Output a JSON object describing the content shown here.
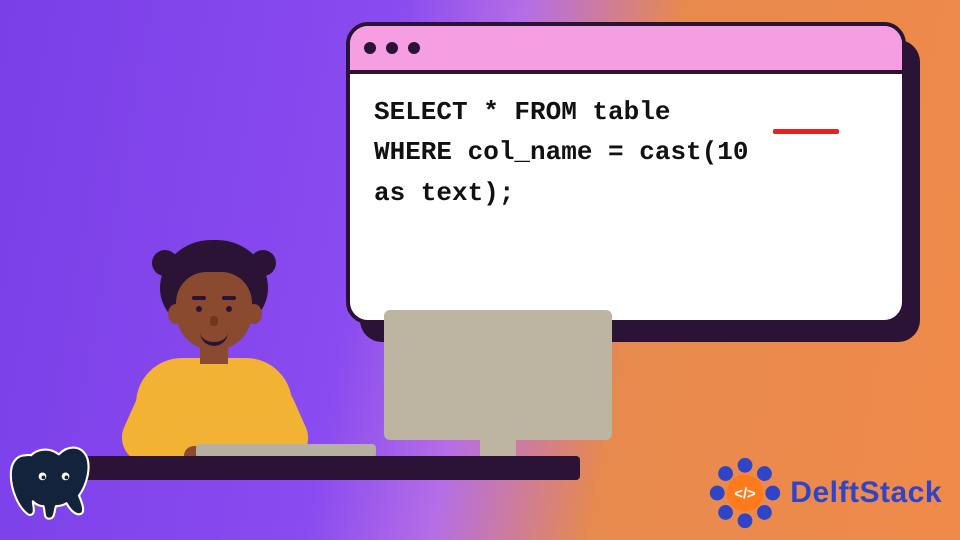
{
  "code": {
    "line1": "SELECT * FROM table",
    "line2": "WHERE col_name = cast(10",
    "line3": "as text);"
  },
  "brand": {
    "name": "DelftStack"
  },
  "icons": {
    "bottom_left": "postgresql-elephant",
    "bottom_right_badge": "delftstack-code-badge"
  },
  "colors": {
    "window_border": "#2a1334",
    "titlebar": "#f59fe2",
    "underline": "#e02424",
    "shirt": "#f2b233",
    "brand_blue": "#3044c8"
  }
}
